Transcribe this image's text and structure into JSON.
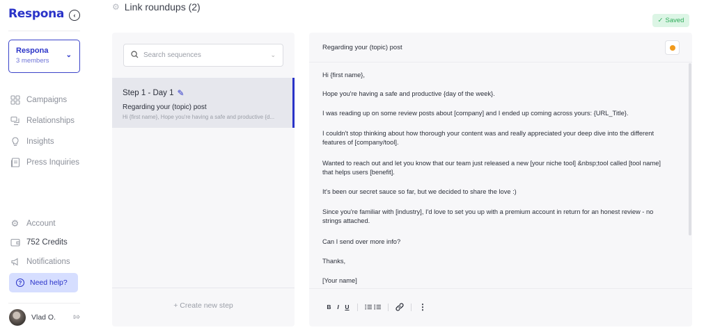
{
  "sidebar": {
    "logo": "Respona",
    "workspace": {
      "name": "Respona",
      "members": "3 members"
    },
    "nav": [
      {
        "label": "Campaigns",
        "icon": "grid-icon"
      },
      {
        "label": "Relationships",
        "icon": "chat-icon"
      },
      {
        "label": "Insights",
        "icon": "lightbulb-icon"
      },
      {
        "label": "Press Inquiries",
        "icon": "document-icon"
      }
    ],
    "bottom": {
      "account": "Account",
      "credits": "752 Credits",
      "notifications": "Notifications",
      "help": "Need help?"
    },
    "user": {
      "name": "Vlad O."
    }
  },
  "header": {
    "title": "Link roundups (2)",
    "saved": "Saved"
  },
  "steps": {
    "search_placeholder": "Search sequences",
    "items": [
      {
        "title": "Step 1 - Day 1",
        "subject": "Regarding your (topic) post",
        "preview": "Hi {first name}, Hope you're having a safe and productive {d..."
      }
    ],
    "new_step": "+ Create new step"
  },
  "editor": {
    "subject": "Regarding your (topic) post",
    "body": [
      "Hi {first name},",
      "Hope you're having a safe and productive {day of the week}.",
      "I was reading up on some review posts about [company] and I ended up coming across yours: {URL_Title}.",
      "I couldn't stop thinking about how thorough your content was and really appreciated your deep dive into the different features of [company/tool].",
      "Wanted to reach out and let you know that our team just released a new [your niche tool] &nbsp;tool called [tool name] that helps users [benefit].",
      "It's been our secret sauce so far, but we decided to share the love :)",
      "Since you're familiar with [industry], I'd love to set you up with a premium account in return for an honest review - no strings attached.",
      "Can I send over more info?",
      "Thanks,",
      "[Your name]"
    ],
    "toolbar": {
      "bold": "B",
      "italic": "I",
      "underline": "U",
      "ordered_list": "⁝≡",
      "bullet_list": "∷≡",
      "link": "🔗",
      "more": "⋮"
    }
  },
  "colors": {
    "brand": "#2a33c8",
    "saved_bg": "#dcf5e5",
    "saved_text": "#2eac5a",
    "status_dot": "#f19a1c",
    "help_bg": "#d6deff"
  }
}
